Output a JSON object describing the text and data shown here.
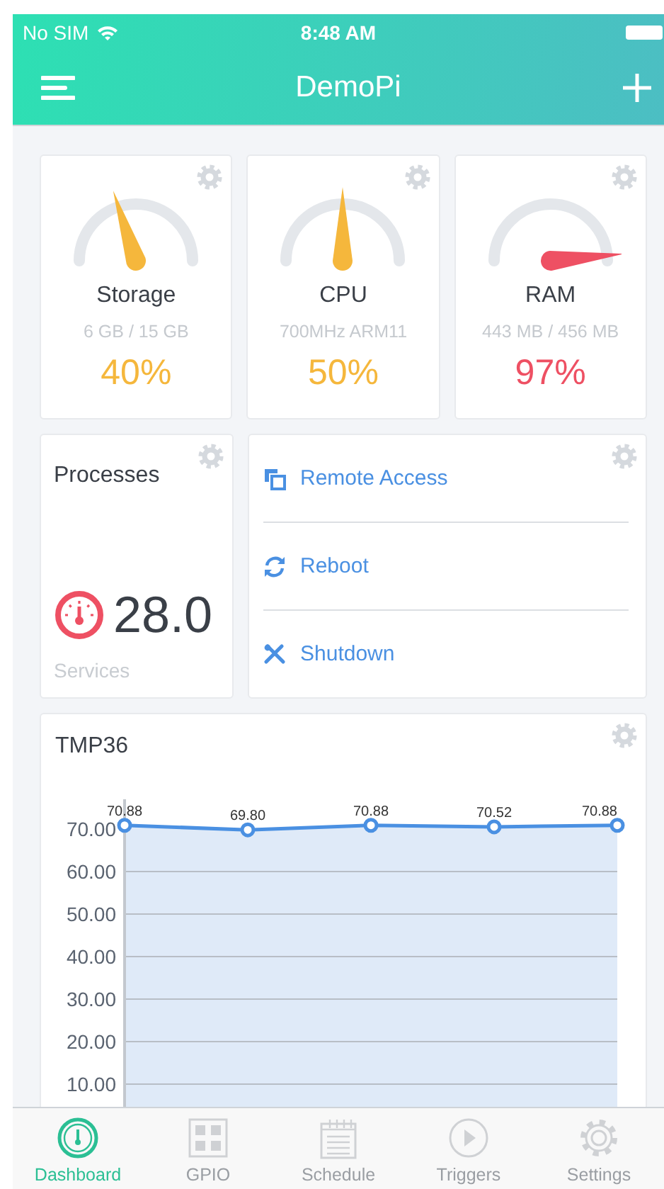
{
  "status_bar": {
    "carrier": "No SIM",
    "time": "8:48 AM"
  },
  "nav_bar": {
    "title": "DemoPi"
  },
  "gauges": [
    {
      "title": "Storage",
      "detail": "6 GB / 15 GB",
      "percent": "40%",
      "color": "#f5b73c"
    },
    {
      "title": "CPU",
      "detail": "700MHz ARM11",
      "percent": "50%",
      "color": "#f5b73c"
    },
    {
      "title": "RAM",
      "detail": "443 MB / 456 MB",
      "percent": "97%",
      "color": "#ee5063"
    }
  ],
  "processes": {
    "title": "Processes",
    "value": "28.0",
    "caption": "Services"
  },
  "actions": [
    {
      "kind": "remote",
      "label": "Remote Access"
    },
    {
      "kind": "reboot",
      "label": "Reboot"
    },
    {
      "kind": "shutdown",
      "label": "Shutdown"
    }
  ],
  "sensor": {
    "chart_data": {
      "type": "line",
      "title": "TMP36",
      "grid": true,
      "series": [
        {
          "color": "#4a90e2",
          "marker": "circle",
          "values": [
            70.88,
            69.8,
            70.88,
            70.52,
            70.88
          ]
        }
      ],
      "yticks": [
        {
          "value": 10,
          "label": "10.00"
        },
        {
          "value": 20,
          "label": "20.00"
        },
        {
          "value": 30,
          "label": "30.00"
        },
        {
          "value": 40,
          "label": "40.00"
        },
        {
          "value": 50,
          "label": "50.00"
        },
        {
          "value": 60,
          "label": "60.00"
        },
        {
          "value": 70,
          "label": "70.00"
        }
      ],
      "ylim": [
        0,
        77
      ],
      "value_labels": [
        "70.88",
        "69.80",
        "70.88",
        "70.52",
        "70.88"
      ]
    }
  },
  "tabs": [
    {
      "label": "Dashboard",
      "selected": true
    },
    {
      "label": "GPIO",
      "selected": false
    },
    {
      "label": "Schedule",
      "selected": false
    },
    {
      "label": "Triggers",
      "selected": false
    },
    {
      "label": "Settings",
      "selected": false
    }
  ]
}
